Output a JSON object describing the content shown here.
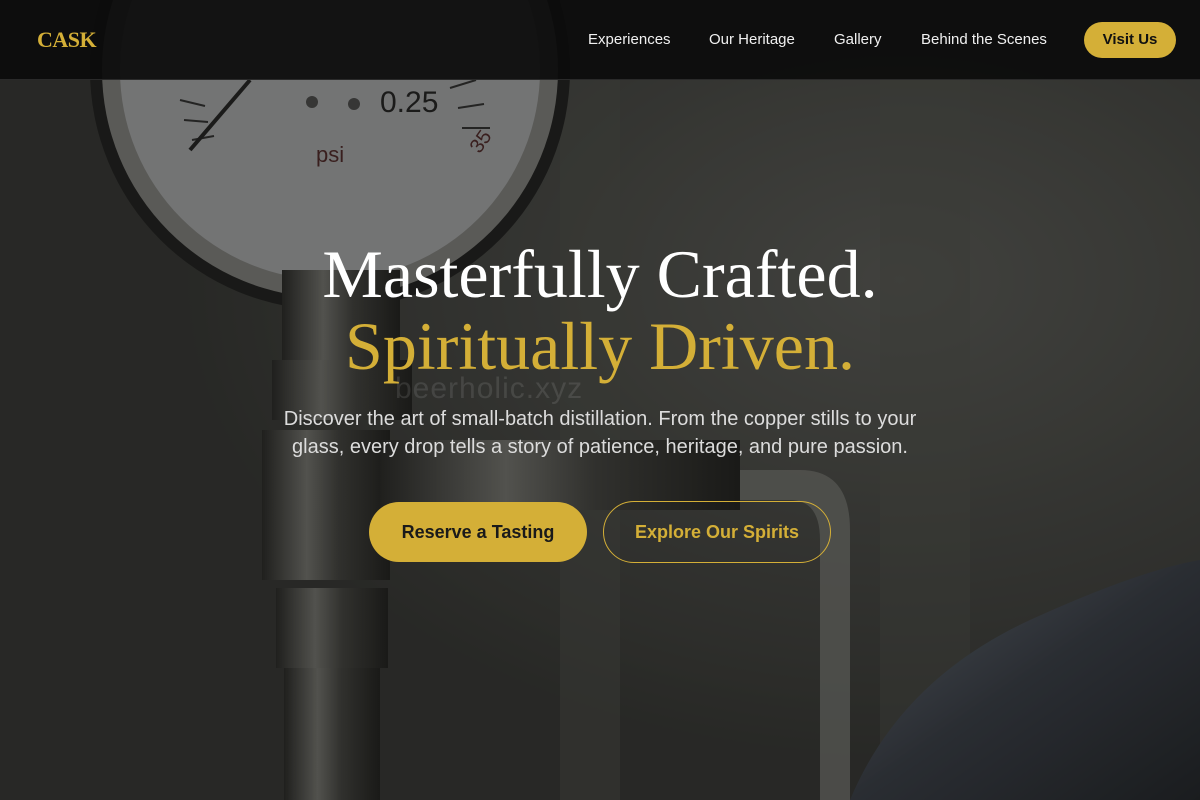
{
  "brand": {
    "logo": "CASK",
    "accent": "#d4af37"
  },
  "nav": {
    "items": [
      "Experiences",
      "Our Heritage",
      "Gallery",
      "Behind the Scenes"
    ],
    "cta": "Visit Us"
  },
  "hero": {
    "line1": "Masterfully Crafted.",
    "line2": "Spiritually Driven.",
    "sub1": "Discover the art of small-batch distillation. From the copper stills to your",
    "sub2": "glass, every drop tells a story of patience, heritage, and pure passion.",
    "primary_cta": "Reserve a Tasting",
    "secondary_cta": "Explore Our Spirits",
    "watermark": "beerholic.xyz"
  },
  "gauge": {
    "reading_label": "0.25",
    "unit": "psi",
    "scale_label": "35"
  },
  "icons": [
    "pressure-gauge-image"
  ]
}
